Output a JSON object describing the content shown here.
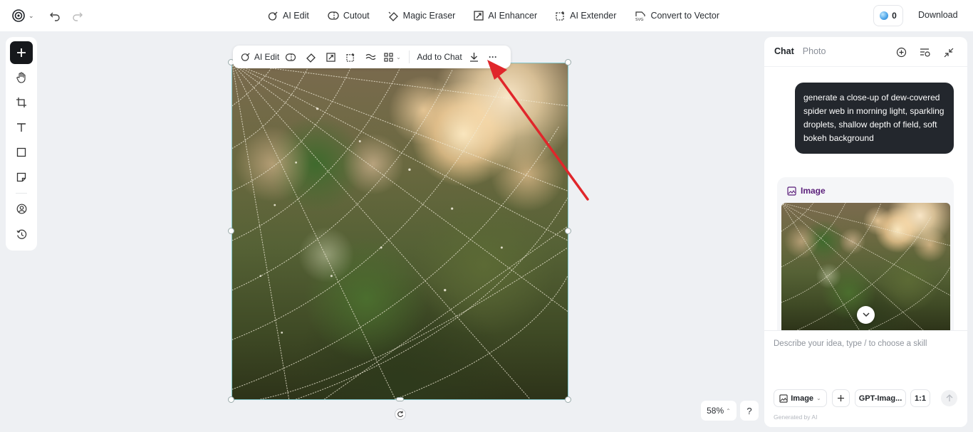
{
  "topbar": {
    "tools": [
      {
        "label": "AI Edit",
        "icon": "ai-edit-icon"
      },
      {
        "label": "Cutout",
        "icon": "cutout-icon"
      },
      {
        "label": "Magic Eraser",
        "icon": "eraser-icon"
      },
      {
        "label": "AI Enhancer",
        "icon": "enhancer-icon"
      },
      {
        "label": "AI Extender",
        "icon": "extender-icon"
      },
      {
        "label": "Convert to Vector",
        "icon": "svg-icon"
      }
    ],
    "credits": "0",
    "download_label": "Download"
  },
  "image_toolbar": {
    "ai_edit_label": "AI Edit",
    "add_to_chat_label": "Add to Chat",
    "more_label": "···"
  },
  "canvas": {
    "zoom": "58%",
    "help_label": "?"
  },
  "chat": {
    "tabs": [
      "Chat",
      "Photo"
    ],
    "user_message": "generate a close-up of dew-covered spider web in morning light, sparkling droplets, shallow depth of field, soft bokeh background",
    "result_label": "Image",
    "input_placeholder": "Describe your idea, type / to choose a skill",
    "image_mode_label": "Image",
    "model_label": "GPT-Imag...",
    "ratio_label": "1:1",
    "footer_note": "Generated by AI"
  },
  "colors": {
    "accent_dark": "#16181c",
    "annotation_arrow": "#e0262b",
    "result_label": "#5a1e7a"
  }
}
